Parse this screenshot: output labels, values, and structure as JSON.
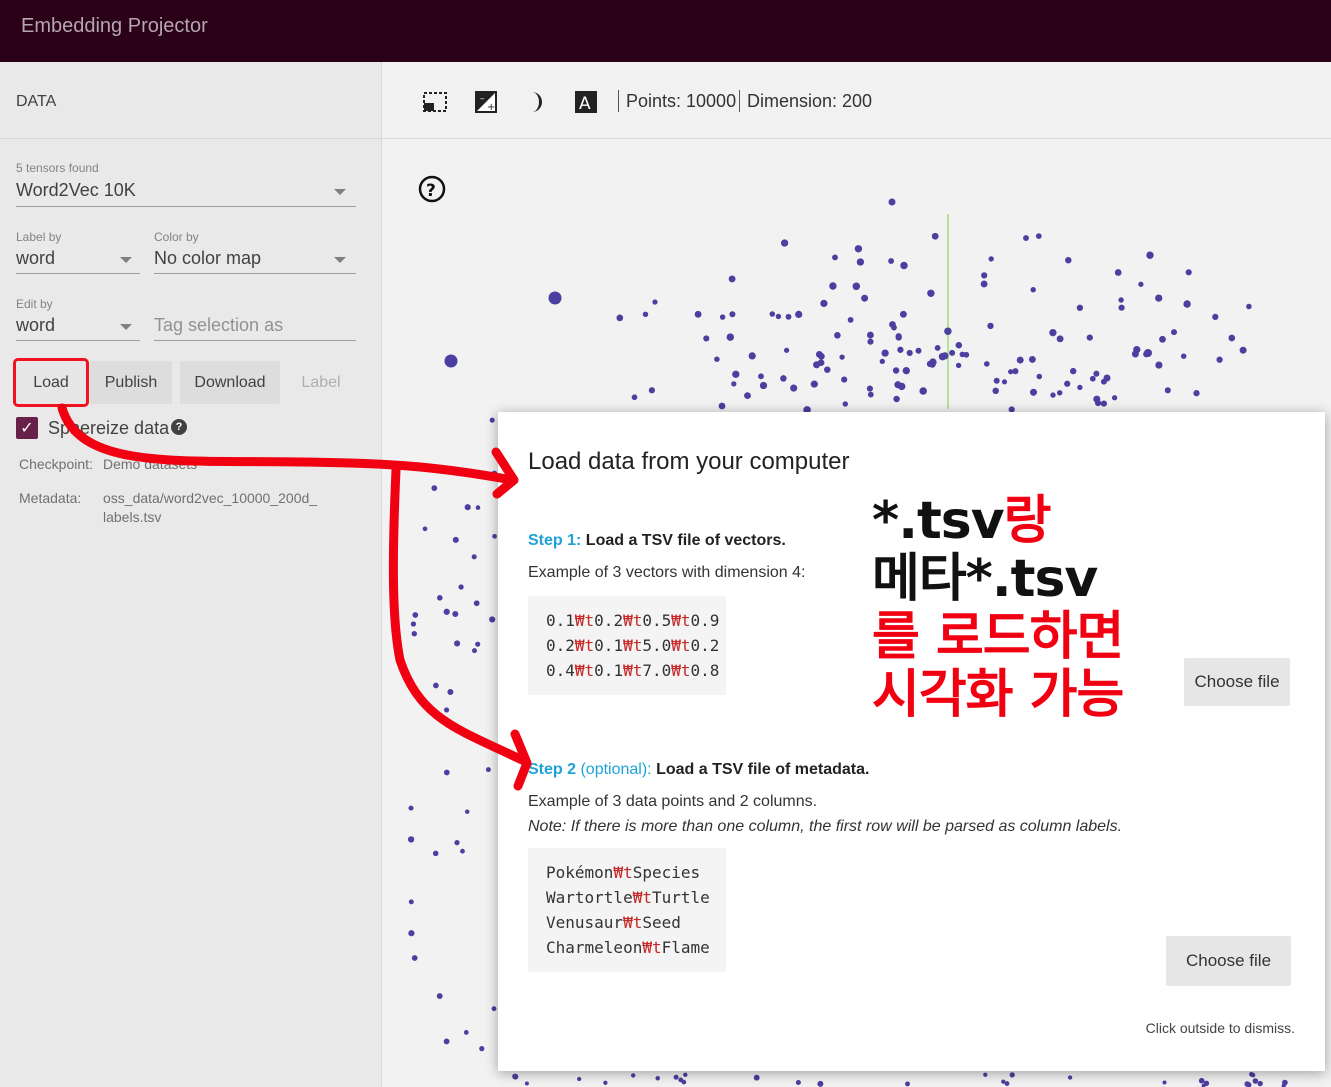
{
  "app": {
    "title": "Embedding Projector"
  },
  "left": {
    "section_title": "DATA",
    "tensors_label": "5 tensors found",
    "tensor_value": "Word2Vec 10K",
    "label_by_label": "Label by",
    "label_by_value": "word",
    "color_by_label": "Color by",
    "color_by_value": "No color map",
    "edit_by_label": "Edit by",
    "edit_by_value": "word",
    "tag_placeholder": "Tag selection as",
    "buttons": {
      "load": "Load",
      "publish": "Publish",
      "download": "Download",
      "label": "Label"
    },
    "sphereize_label": "Sphereize data",
    "checkpoint_label": "Checkpoint:",
    "checkpoint_value": "Demo datasets",
    "metadata_label": "Metadata:",
    "metadata_value_line1": "oss_data/word2vec_10000_200d_",
    "metadata_value_line2": "labels.tsv"
  },
  "toolbar": {
    "points": "Points: 10000",
    "dimension": "Dimension: 200",
    "icons": [
      "select-region-icon",
      "night-mode-icon",
      "dark-toggle-icon",
      "label-icon"
    ]
  },
  "modal": {
    "title": "Load data from your computer",
    "step1_prefix": "Step 1:",
    "step1_text": "Load a TSV file of vectors.",
    "step1_example": "Example of 3 vectors with dimension 4:",
    "vectors": [
      [
        "0.1",
        "0.2",
        "0.5",
        "0.9"
      ],
      [
        "0.2",
        "0.1",
        "5.0",
        "0.2"
      ],
      [
        "0.4",
        "0.1",
        "7.0",
        "0.8"
      ]
    ],
    "separator": "₩t",
    "choose_file": "Choose file",
    "step2_prefix": "Step 2",
    "step2_optional": "(optional):",
    "step2_text": "Load a TSV file of metadata.",
    "step2_example": "Example of 3 data points and 2 columns.",
    "step2_note": "Note: If there is more than one column, the first row will be parsed as column labels.",
    "metadata": [
      [
        "Pokémon",
        "Species"
      ],
      [
        "Wartortle",
        "Turtle"
      ],
      [
        "Venusaur",
        "Seed"
      ],
      [
        "Charmeleon",
        "Flame"
      ]
    ],
    "choose_file_2": "Choose file",
    "dismiss": "Click outside to dismiss."
  },
  "annotation": {
    "line1_black": "*.tsv",
    "line1_red": "랑",
    "line2": "메타*.tsv",
    "line3": "를 로드하면",
    "line4": "시각화 가능",
    "color_red": "#f00010"
  }
}
